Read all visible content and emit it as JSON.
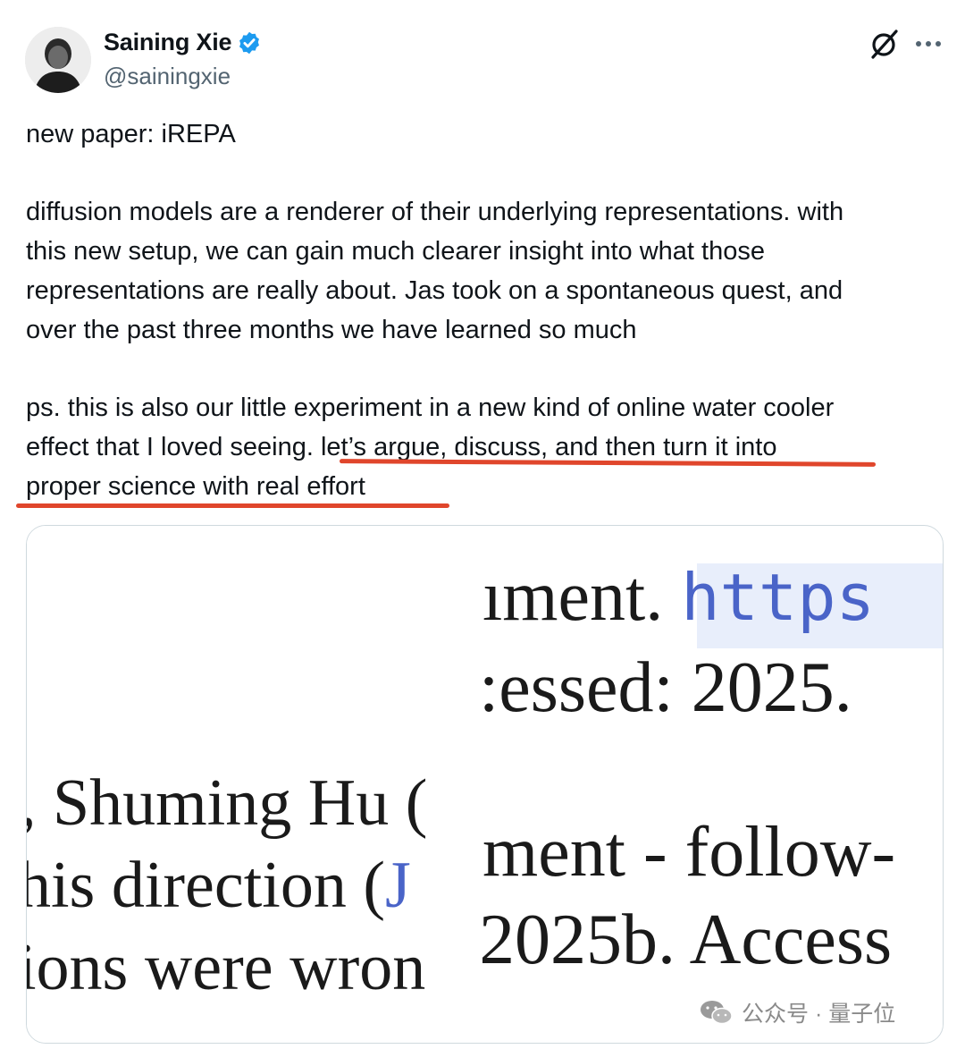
{
  "author": {
    "display_name": "Saining Xie",
    "handle": "@sainingxie",
    "verified": true
  },
  "header_icons": [
    "grok-icon",
    "more-icon"
  ],
  "tweet": {
    "line_1": "new paper: iREPA",
    "para_2": [
      "diffusion models are a renderer of their underlying representations. with",
      "this new setup, we can gain much clearer insight into what those",
      "representations are really about. Jas took on a spontaneous quest, and",
      "over the past three months we have learned so much"
    ],
    "para_3": [
      "ps. this is also our little experiment in a new kind of online water cooler",
      "effect that I loved seeing. let’s argue, discuss, and then turn it into",
      "proper science with real effort"
    ]
  },
  "media": {
    "left_lines": [
      ", Shuming Hu (",
      "his direction (J",
      "ions were wron"
    ],
    "right_top_lines": [
      "ıment. https",
      ":essed: 2025."
    ],
    "right_bottom_lines": [
      "ment - follow-",
      "2025b. Access"
    ]
  },
  "watermark": {
    "text": "公众号 · 量子位"
  },
  "colors": {
    "verified_blue": "#1d9bf0",
    "underline_red": "#e0462c",
    "link_blue": "#4a64c8",
    "handle_gray": "#536471"
  }
}
